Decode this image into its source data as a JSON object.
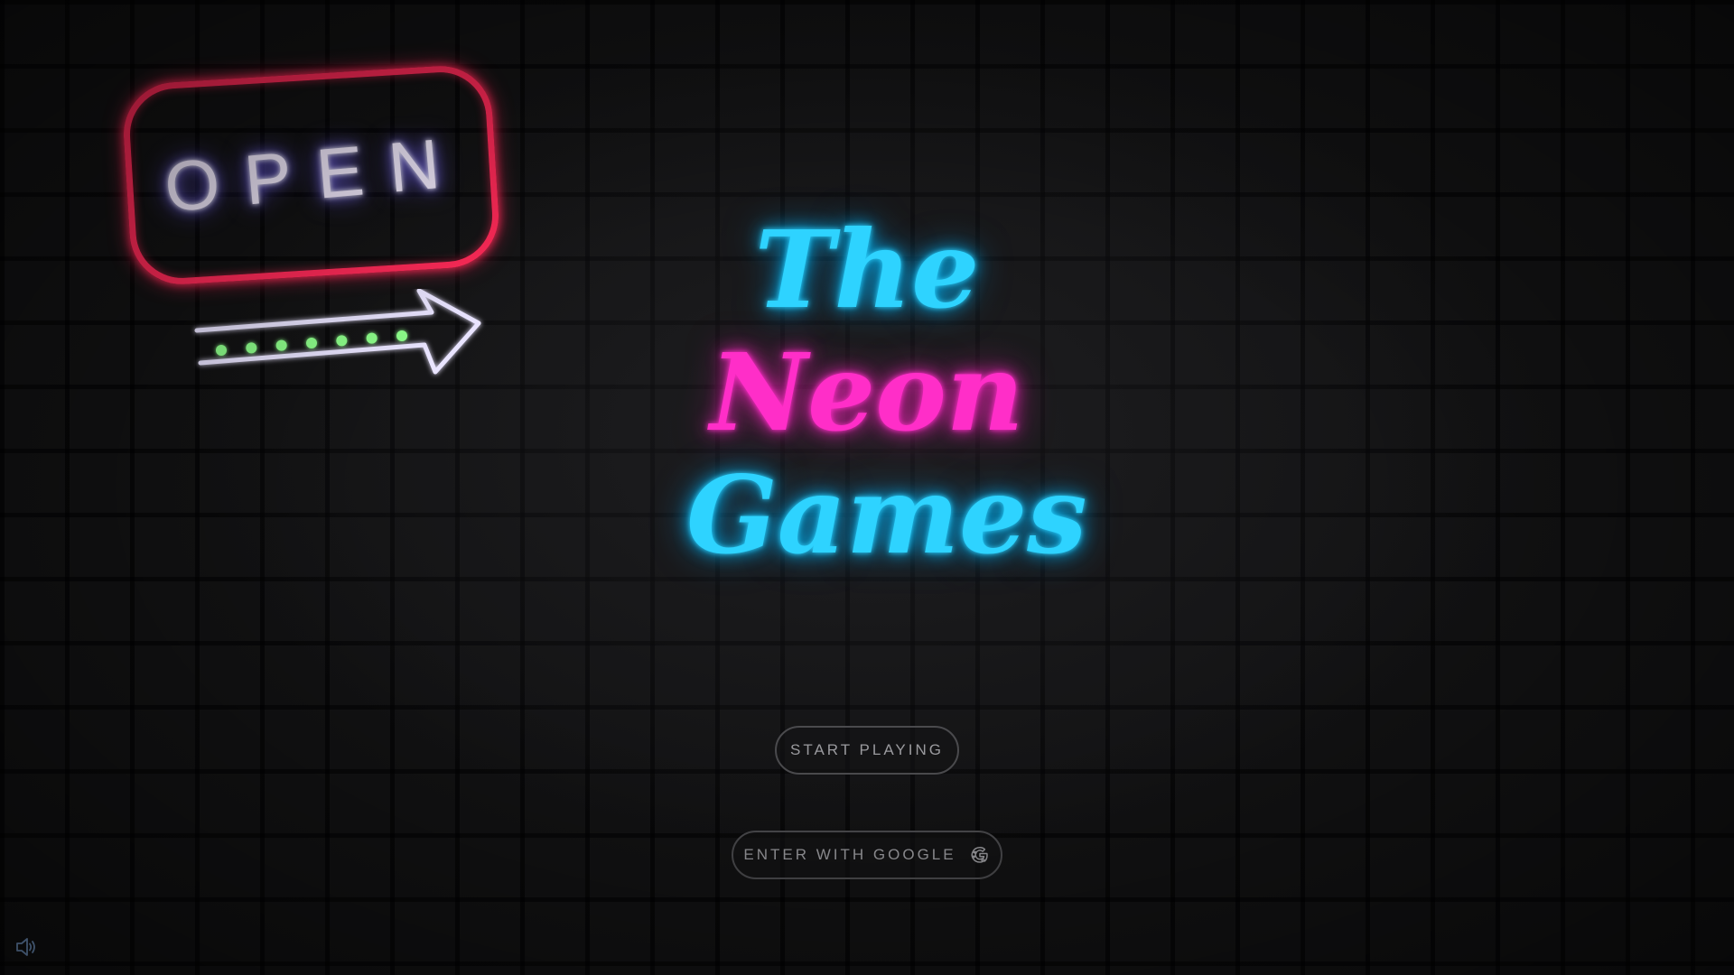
{
  "open_sign": {
    "text": "OPEN",
    "frame_color": "#ff2a58",
    "text_color": "#f4ecff",
    "arrow_color": "#e9e4ff",
    "dot_color": "#8dff8a",
    "arrow_dots": 7
  },
  "title": {
    "line1": "The",
    "line2": "Neon",
    "line3": "Games",
    "colors": {
      "cyan": "#2ed3ff",
      "magenta": "#ff2ec8"
    }
  },
  "buttons": {
    "start_label": "START PLAYING",
    "google_label": "ENTER WITH GOOGLE",
    "google_icon": "google-icon"
  },
  "sound": {
    "icon": "speaker-icon"
  },
  "theme": {
    "background": "#121213",
    "button_border": "#4a4a4d",
    "button_text": "#9a9a9e"
  }
}
